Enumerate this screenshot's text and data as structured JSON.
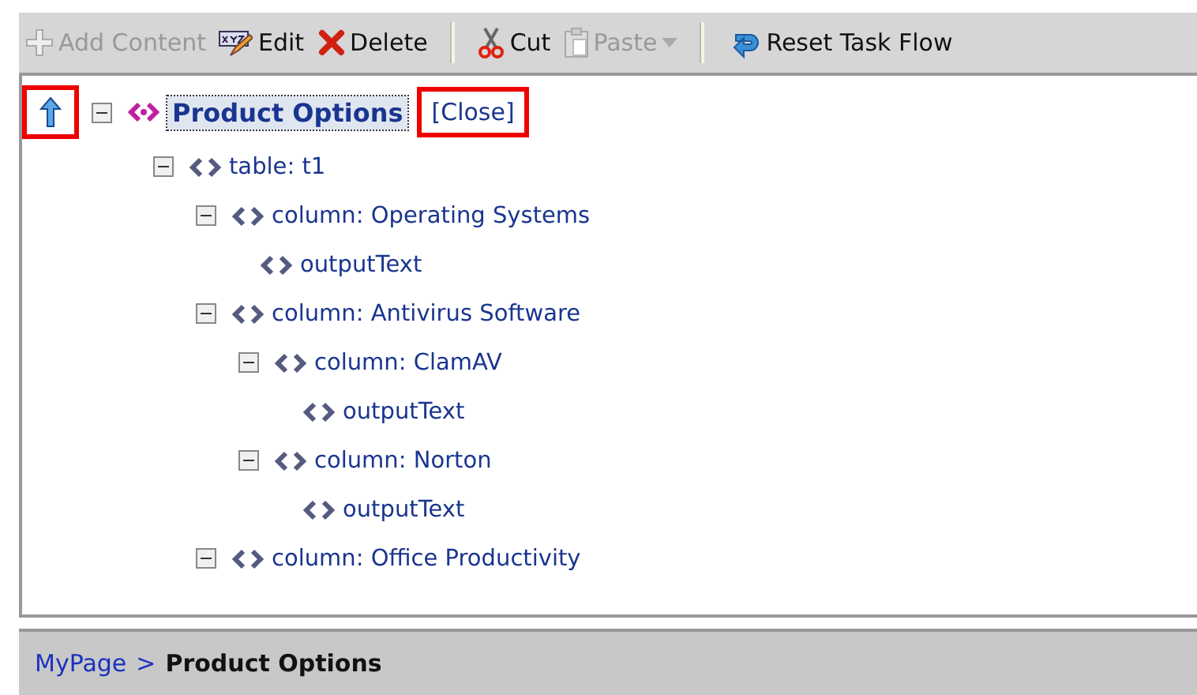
{
  "toolbar": [
    {
      "kind": "add",
      "label": "Add Content",
      "disabled": true
    },
    {
      "kind": "edit",
      "label": "Edit",
      "disabled": false
    },
    {
      "kind": "delete",
      "label": "Delete",
      "disabled": false
    },
    {
      "kind": "separator"
    },
    {
      "kind": "cut",
      "label": "Cut",
      "disabled": false
    },
    {
      "kind": "paste",
      "label": "Paste",
      "disabled": true
    },
    {
      "kind": "separator"
    },
    {
      "kind": "reset",
      "label": "Reset Task Flow",
      "disabled": false
    }
  ],
  "tree": {
    "up_button": {
      "highlighted": true
    },
    "close_link": {
      "label": "[Close]",
      "highlighted": true
    },
    "root": {
      "label": "Product Options",
      "expanded": true,
      "selected": true,
      "children": [
        {
          "label": "table: t1",
          "expanded": true,
          "children": [
            {
              "label": "column: Operating Systems",
              "expanded": true,
              "children": [
                {
                  "label": "outputText"
                }
              ]
            },
            {
              "label": "column: Antivirus Software",
              "expanded": true,
              "children": [
                {
                  "label": "column: ClamAV",
                  "expanded": true,
                  "children": [
                    {
                      "label": "outputText"
                    }
                  ]
                },
                {
                  "label": "column: Norton",
                  "expanded": true,
                  "children": [
                    {
                      "label": "outputText"
                    }
                  ]
                }
              ]
            },
            {
              "label": "column: Office Productivity",
              "expanded": true
            }
          ]
        }
      ]
    }
  },
  "breadcrumb": [
    {
      "label": "MyPage",
      "current": false
    },
    {
      "label": "Product Options",
      "current": true
    }
  ],
  "breadcrumb_separator": ">"
}
